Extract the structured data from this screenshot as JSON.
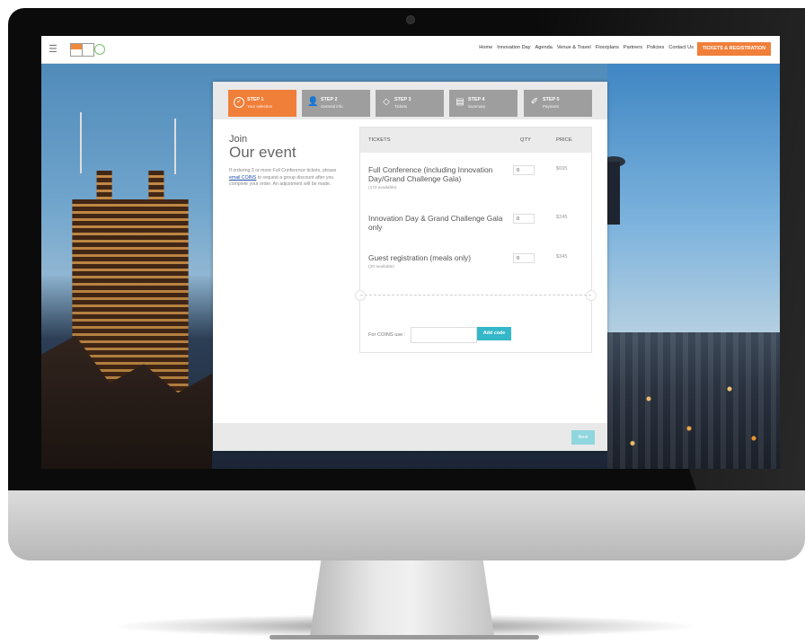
{
  "nav": {
    "menu_icon": "hamburger-icon",
    "links": [
      "Home",
      "Innovation Day",
      "Agenda",
      "Venue & Travel",
      "Floorplans",
      "Partners",
      "Policies",
      "Contact Us"
    ],
    "cta": "TICKETS & REGISTRATION",
    "accent_color": "#f07f3a"
  },
  "steps": [
    {
      "title": "STEP 1",
      "subtitle": "Your selection",
      "icon": "check-circle-icon",
      "active": true
    },
    {
      "title": "STEP 2",
      "subtitle": "General info",
      "icon": "user-icon",
      "active": false
    },
    {
      "title": "STEP 3",
      "subtitle": "Tickets",
      "icon": "tag-icon",
      "active": false
    },
    {
      "title": "STEP 4",
      "subtitle": "Summary",
      "icon": "clipboard-icon",
      "active": false
    },
    {
      "title": "STEP 5",
      "subtitle": "Payment",
      "icon": "payment-icon",
      "active": false
    }
  ],
  "intro": {
    "join": "Join",
    "title": "Our event",
    "note_before": "If ordering 3 or more Full Conference tickets, please",
    "note_link": "email COINS",
    "note_after": "to request a group discount after you complete your order. An adjustment will be made."
  },
  "tickets": {
    "headers": {
      "tickets": "TICKETS",
      "qty": "QTY",
      "price": "PRICE"
    },
    "rows": [
      {
        "name": "Full Conference (including Innovation Day/Grand Challenge Gala)",
        "availability": "(172 available)",
        "qty": "0",
        "price": "$695"
      },
      {
        "name": "Innovation Day & Grand Challenge Gala only",
        "availability": "",
        "qty": "0",
        "price": "$245"
      },
      {
        "name": "Guest registration (meals only)",
        "availability": "(20 available)",
        "qty": "0",
        "price": "$345"
      }
    ],
    "promo_label": "For COINS use :",
    "promo_placeholder": "",
    "promo_button": "Add code"
  },
  "footer": {
    "next_label": "Next",
    "next_color": "#8fd6de"
  }
}
